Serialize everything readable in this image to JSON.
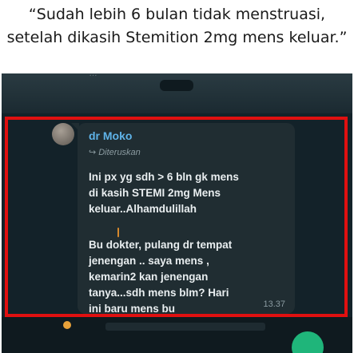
{
  "caption": {
    "line1": "“Sudah lebih 6 bulan tidak menstruasi,",
    "line2": "setelah dikasih Stemition 2mg mens keluar.”"
  },
  "chat": {
    "header_faded_text": "...",
    "sender": "dr Moko",
    "forwarded_label": "Diteruskan",
    "message_part1": [
      "Ini px yg sdh > 6 bln gk mens",
      "di kasih STEMI 2mg Mens",
      "keluar..Alhamdulillah"
    ],
    "message_part2": [
      "Bu dokter, pulang dr tempat",
      "jenengan .. saya mens ,",
      "kemarin2 kan jenengan",
      "tanya...sdh mens blm? Hari",
      "ini baru mens bu"
    ],
    "time": "13.37"
  },
  "colors": {
    "highlight_frame": "#e01010",
    "sender_name": "#5fb3e8",
    "bubble": "#202d32",
    "send_button": "#1fb57a"
  },
  "icons": {
    "forward": "forward-arrow-icon",
    "avatar": "contact-avatar",
    "emoji": "emoji-icon"
  }
}
